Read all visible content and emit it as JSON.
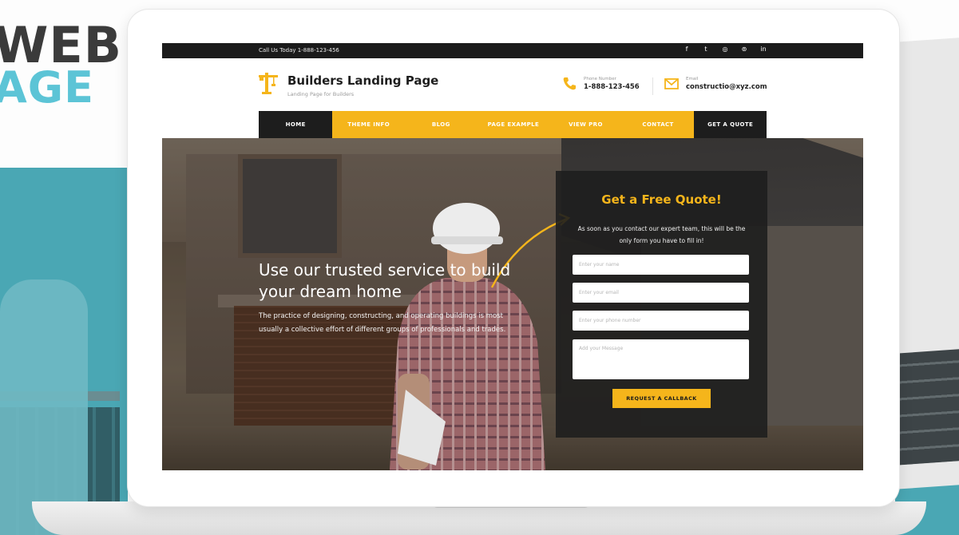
{
  "promo": {
    "line1": "WEB",
    "line2": "AGE"
  },
  "topbar": {
    "call_text": "Call Us Today 1-888-123-456",
    "social_icons": [
      "facebook-icon",
      "twitter-icon",
      "instagram-icon",
      "pinterest-icon",
      "linkedin-icon"
    ],
    "social_glyphs": [
      "f",
      "t",
      "◎",
      "⊚",
      "in"
    ]
  },
  "header": {
    "site_title": "Builders Landing Page",
    "tagline": "Landing Page for Builders",
    "phone_label": "Phone Number",
    "phone_value": "1-888-123-456",
    "email_label": "Email",
    "email_value": "constructio@xyz.com"
  },
  "nav": {
    "items": [
      "HOME",
      "THEME INFO",
      "BLOG",
      "PAGE EXAMPLE",
      "VIEW PRO",
      "CONTACT"
    ],
    "cta": "GET A QUOTE"
  },
  "hero": {
    "title": "Use our trusted service to build your dream home",
    "text": "The practice of designing, constructing, and operating buildings is most usually a collective effort of different groups of professionals and trades."
  },
  "quote_form": {
    "title": "Get a Free Quote!",
    "description": "As soon as you contact our expert team, this will be the only form you have to fill in!",
    "name_placeholder": "Enter your name",
    "email_placeholder": "Enter your email",
    "phone_placeholder": "Enter your phone number",
    "message_placeholder": "Add your Message",
    "submit_label": "REQUEST A CALLBACK"
  },
  "colors": {
    "accent": "#f5b51b",
    "dark": "#1d1d1d",
    "promo_teal": "#5cc4d6"
  }
}
